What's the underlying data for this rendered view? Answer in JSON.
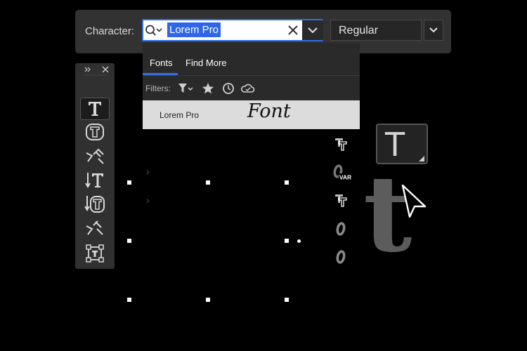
{
  "character": {
    "label": "Character:",
    "search_value": "Lorem Pro",
    "style_value": "Regular"
  },
  "dropdown": {
    "tabs": [
      {
        "label": "Fonts",
        "active": true
      },
      {
        "label": "Find More",
        "active": false
      }
    ],
    "filters_label": "Filters:",
    "filter_icons": [
      "filter-icon",
      "star-icon",
      "clock-icon",
      "cloud-icon"
    ],
    "results": [
      {
        "name": "Lorem Pro",
        "preview": "Font"
      }
    ]
  },
  "tool_panel": {
    "tools": [
      {
        "icon": "horizontal-type-tool-icon",
        "active": true
      },
      {
        "icon": "horizontal-type-mask-tool-icon",
        "active": false
      },
      {
        "icon": "type-on-path-tool-icon",
        "active": false
      },
      {
        "icon": "vertical-type-tool-icon",
        "active": false
      },
      {
        "icon": "vertical-type-mask-tool-icon",
        "active": false
      },
      {
        "icon": "vertical-type-on-path-tool-icon",
        "active": false
      },
      {
        "icon": "text-frame-tool-icon",
        "active": false
      }
    ]
  },
  "font_type_icons": [
    {
      "icon": "truetype-font-icon"
    },
    {
      "icon": "variable-font-icon",
      "badge": "VAR"
    },
    {
      "icon": "truetype-font-icon"
    },
    {
      "icon": "opentype-font-icon"
    },
    {
      "icon": "opentype-font-icon"
    }
  ],
  "big_type_button": {
    "glyph": "T"
  },
  "large_glyph": "t",
  "colors": {
    "accent": "#2f6fe0",
    "panel": "#323232",
    "background": "#000000"
  }
}
